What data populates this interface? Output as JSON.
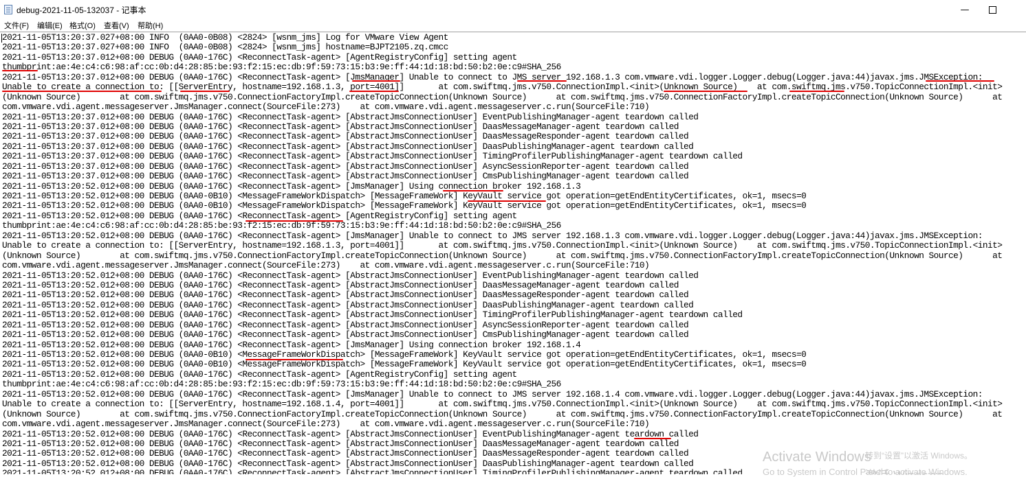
{
  "window": {
    "title": "debug-2021-11-05-132037 - 记事本",
    "minimize_symbol": "—"
  },
  "menu": [
    "文件(F)",
    "编辑(E)",
    "格式(O)",
    "查看(V)",
    "帮助(H)"
  ],
  "log_lines": [
    "2021-11-05T13:20:37.027+08:00 INFO  (0AA0-0B08) <2824> [wsnm_jms] Log for VMware View Agent",
    "2021-11-05T13:20:37.027+08:00 INFO  (0AA0-0B08) <2824> [wsnm_jms] hostname=BJPT2105.zq.cmcc",
    "2021-11-05T13:20:37.012+08:00 DEBUG (0AA0-176C) <ReconnectTask-agent> [AgentRegistryConfig] setting agent",
    "thumbprint:ae:4e:c4:c6:98:af:cc:0b:d4:28:85:be:93:f2:15:ec:db:9f:59:73:15:b3:9e:ff:44:1d:18:bd:50:b2:0e:c9#SHA_256",
    "2021-11-05T13:20:37.012+08:00 DEBUG (0AA0-176C) <ReconnectTask-agent> [JmsManager] Unable to connect to JMS server 192.168.1.3 com.vmware.vdi.logger.Logger.debug(Logger.java:44)javax.jms.JMSException:",
    "Unable to create a connection to: [[ServerEntry, hostname=192.168.1.3, port=4001]]       at com.swiftmq.jms.v750.ConnectionImpl.<init>(Unknown Source)    at com.swiftmq.jms.v750.TopicConnectionImpl.<init>",
    "(Unknown Source)        at com.swiftmq.jms.v750.ConnectionFactoryImpl.createTopicConnection(Unknown Source)      at com.swiftmq.jms.v750.ConnectionFactoryImpl.createTopicConnection(Unknown Source)      at",
    "com.vmware.vdi.agent.messageserver.JmsManager.connect(SourceFile:273)    at com.vmware.vdi.agent.messageserver.c.run(SourceFile:710)",
    "2021-11-05T13:20:37.012+08:00 DEBUG (0AA0-176C) <ReconnectTask-agent> [AbstractJmsConnectionUser] EventPublishingManager-agent teardown called",
    "2021-11-05T13:20:37.012+08:00 DEBUG (0AA0-176C) <ReconnectTask-agent> [AbstractJmsConnectionUser] DaasMessageManager-agent teardown called",
    "2021-11-05T13:20:37.012+08:00 DEBUG (0AA0-176C) <ReconnectTask-agent> [AbstractJmsConnectionUser] DaasMessageResponder-agent teardown called",
    "2021-11-05T13:20:37.012+08:00 DEBUG (0AA0-176C) <ReconnectTask-agent> [AbstractJmsConnectionUser] DaasPublishingManager-agent teardown called",
    "2021-11-05T13:20:37.012+08:00 DEBUG (0AA0-176C) <ReconnectTask-agent> [AbstractJmsConnectionUser] TimingProfilerPublishingManager-agent teardown called",
    "2021-11-05T13:20:37.012+08:00 DEBUG (0AA0-176C) <ReconnectTask-agent> [AbstractJmsConnectionUser] AsyncSessionReporter-agent teardown called",
    "2021-11-05T13:20:37.012+08:00 DEBUG (0AA0-176C) <ReconnectTask-agent> [AbstractJmsConnectionUser] CmsPublishingManager-agent teardown called",
    "2021-11-05T13:20:52.012+08:00 DEBUG (0AA0-176C) <ReconnectTask-agent> [JmsManager] Using connection broker 192.168.1.3",
    "2021-11-05T13:20:52.012+08:00 DEBUG (0AA0-0B10) <MessageFrameWorkDispatch> [MessageFrameWork] KeyVault service got operation=getEndEntityCertificates, ok=1, msecs=0",
    "2021-11-05T13:20:52.012+08:00 DEBUG (0AA0-0B10) <MessageFrameWorkDispatch> [MessageFrameWork] KeyVault service got operation=getEndEntityCertificates, ok=1, msecs=0",
    "2021-11-05T13:20:52.012+08:00 DEBUG (0AA0-176C) <ReconnectTask-agent> [AgentRegistryConfig] setting agent",
    "thumbprint:ae:4e:c4:c6:98:af:cc:0b:d4:28:85:be:93:f2:15:ec:db:9f:59:73:15:b3:9e:ff:44:1d:18:bd:50:b2:0e:c9#SHA_256",
    "2021-11-05T13:20:52.012+08:00 DEBUG (0AA0-176C) <ReconnectTask-agent> [JmsManager] Unable to connect to JMS server 192.168.1.3 com.vmware.vdi.logger.Logger.debug(Logger.java:44)javax.jms.JMSException:",
    "Unable to create a connection to: [[ServerEntry, hostname=192.168.1.3, port=4001]]       at com.swiftmq.jms.v750.ConnectionImpl.<init>(Unknown Source)    at com.swiftmq.jms.v750.TopicConnectionImpl.<init>",
    "(Unknown Source)        at com.swiftmq.jms.v750.ConnectionFactoryImpl.createTopicConnection(Unknown Source)      at com.swiftmq.jms.v750.ConnectionFactoryImpl.createTopicConnection(Unknown Source)      at",
    "com.vmware.vdi.agent.messageserver.JmsManager.connect(SourceFile:273)    at com.vmware.vdi.agent.messageserver.c.run(SourceFile:710)",
    "2021-11-05T13:20:52.012+08:00 DEBUG (0AA0-176C) <ReconnectTask-agent> [AbstractJmsConnectionUser] EventPublishingManager-agent teardown called",
    "2021-11-05T13:20:52.012+08:00 DEBUG (0AA0-176C) <ReconnectTask-agent> [AbstractJmsConnectionUser] DaasMessageManager-agent teardown called",
    "2021-11-05T13:20:52.012+08:00 DEBUG (0AA0-176C) <ReconnectTask-agent> [AbstractJmsConnectionUser] DaasMessageResponder-agent teardown called",
    "2021-11-05T13:20:52.012+08:00 DEBUG (0AA0-176C) <ReconnectTask-agent> [AbstractJmsConnectionUser] DaasPublishingManager-agent teardown called",
    "2021-11-05T13:20:52.012+08:00 DEBUG (0AA0-176C) <ReconnectTask-agent> [AbstractJmsConnectionUser] TimingProfilerPublishingManager-agent teardown called",
    "2021-11-05T13:20:52.012+08:00 DEBUG (0AA0-176C) <ReconnectTask-agent> [AbstractJmsConnectionUser] AsyncSessionReporter-agent teardown called",
    "2021-11-05T13:20:52.012+08:00 DEBUG (0AA0-176C) <ReconnectTask-agent> [AbstractJmsConnectionUser] CmsPublishingManager-agent teardown called",
    "2021-11-05T13:20:52.012+08:00 DEBUG (0AA0-176C) <ReconnectTask-agent> [JmsManager] Using connection broker 192.168.1.4",
    "2021-11-05T13:20:52.012+08:00 DEBUG (0AA0-0B10) <MessageFrameWorkDispatch> [MessageFrameWork] KeyVault service got operation=getEndEntityCertificates, ok=1, msecs=0",
    "2021-11-05T13:20:52.012+08:00 DEBUG (0AA0-0B10) <MessageFrameWorkDispatch> [MessageFrameWork] KeyVault service got operation=getEndEntityCertificates, ok=1, msecs=0",
    "2021-11-05T13:20:52.012+08:00 DEBUG (0AA0-176C) <ReconnectTask-agent> [AgentRegistryConfig] setting agent",
    "thumbprint:ae:4e:c4:c6:98:af:cc:0b:d4:28:85:be:93:f2:15:ec:db:9f:59:73:15:b3:9e:ff:44:1d:18:bd:50:b2:0e:c9#SHA_256",
    "2021-11-05T13:20:52.012+08:00 DEBUG (0AA0-176C) <ReconnectTask-agent> [JmsManager] Unable to connect to JMS server 192.168.1.4 com.vmware.vdi.logger.Logger.debug(Logger.java:44)javax.jms.JMSException:",
    "Unable to create a connection to: [[ServerEntry, hostname=192.168.1.4, port=4001]]       at com.swiftmq.jms.v750.ConnectionImpl.<init>(Unknown Source)    at com.swiftmq.jms.v750.TopicConnectionImpl.<init>",
    "(Unknown Source)        at com.swiftmq.jms.v750.ConnectionFactoryImpl.createTopicConnection(Unknown Source)      at com.swiftmq.jms.v750.ConnectionFactoryImpl.createTopicConnection(Unknown Source)      at",
    "com.vmware.vdi.agent.messageserver.JmsManager.connect(SourceFile:273)    at com.vmware.vdi.agent.messageserver.c.run(SourceFile:710)",
    "2021-11-05T13:20:52.012+08:00 DEBUG (0AA0-176C) <ReconnectTask-agent> [AbstractJmsConnectionUser] EventPublishingManager-agent teardown called",
    "2021-11-05T13:20:52.012+08:00 DEBUG (0AA0-176C) <ReconnectTask-agent> [AbstractJmsConnectionUser] DaasMessageManager-agent teardown called",
    "2021-11-05T13:20:52.012+08:00 DEBUG (0AA0-176C) <ReconnectTask-agent> [AbstractJmsConnectionUser] DaasMessageResponder-agent teardown called",
    "2021-11-05T13:20:52.012+08:00 DEBUG (0AA0-176C) <ReconnectTask-agent> [AbstractJmsConnectionUser] DaasPublishingManager-agent teardown called",
    "2021-11-05T13:20:52.012+08:00 DEBUG (0AA0-176C) <ReconnectTask-agent> [AbstractJmsConnectionUser] TimingProfilerPublishingManager-agent teardown called"
  ],
  "watermark": {
    "line1": "激活 Windows",
    "line2": "Activate Windows",
    "line2_cn": "转到“设置”以激活 Windows。",
    "line3": "Go to System in Control Panel to activate Windows."
  },
  "annotation_color": "#e00000"
}
